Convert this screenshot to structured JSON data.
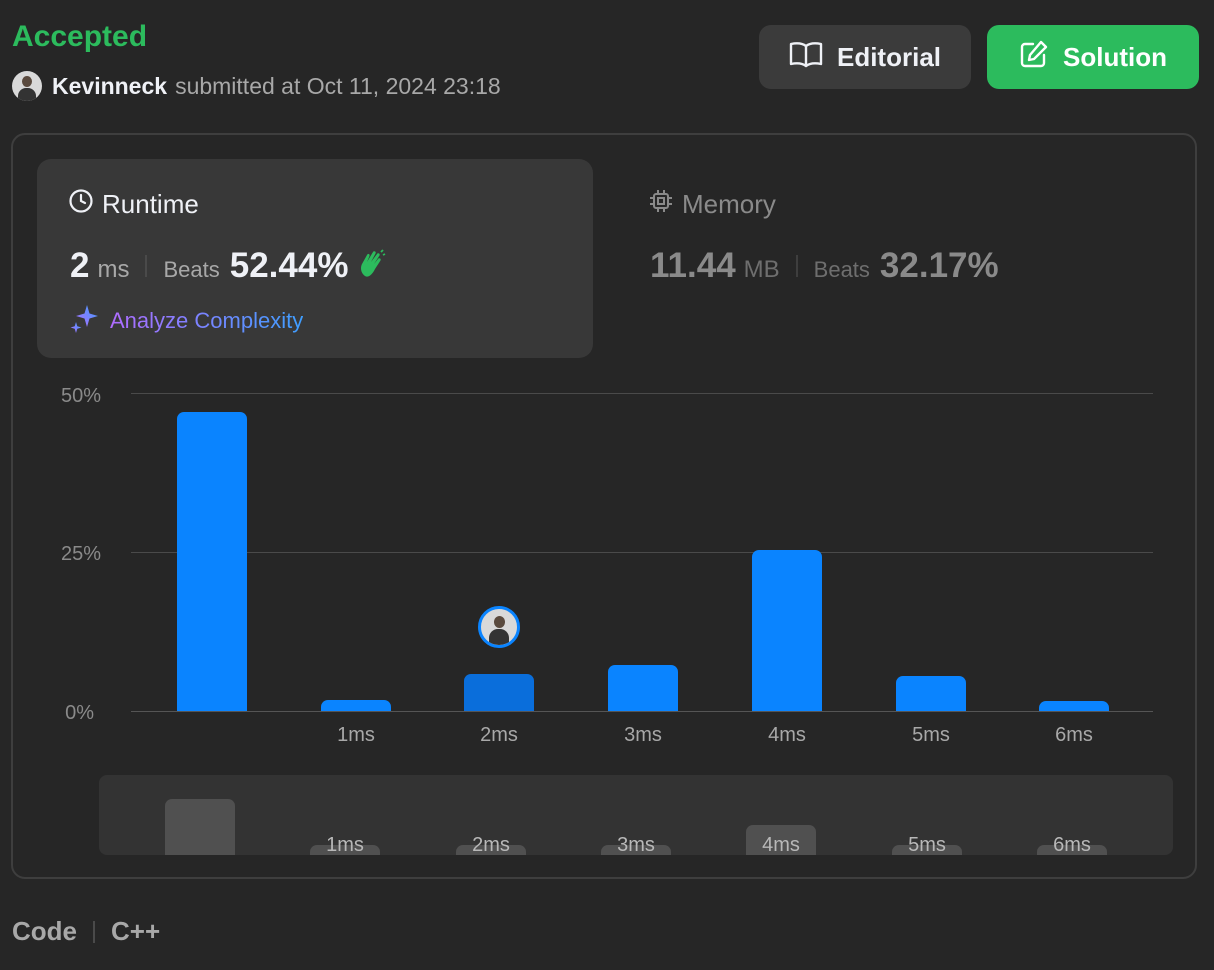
{
  "header": {
    "status": "Accepted",
    "username": "Kevinneck",
    "submitted_text": "submitted at Oct 11, 2024 23:18"
  },
  "buttons": {
    "editorial": "Editorial",
    "solution": "Solution"
  },
  "runtime": {
    "title": "Runtime",
    "value": "2",
    "unit": "ms",
    "beats_label": "Beats",
    "beats_value": "52.44%",
    "analyze_label": "Analyze Complexity"
  },
  "memory": {
    "title": "Memory",
    "value": "11.44",
    "unit": "MB",
    "beats_label": "Beats",
    "beats_value": "32.17%"
  },
  "chart_data": {
    "type": "bar",
    "categories": [
      "",
      "1ms",
      "2ms",
      "3ms",
      "4ms",
      "5ms",
      "6ms"
    ],
    "values": [
      47,
      1.7,
      5.8,
      7.3,
      25.3,
      5.5,
      1.6
    ],
    "yticks": [
      "50%",
      "25%",
      "0%"
    ],
    "ylim": [
      0,
      50
    ],
    "highlight_index": 2
  },
  "mini_chart": {
    "labels": [
      "",
      "1ms",
      "2ms",
      "3ms",
      "4ms",
      "5ms",
      "6ms"
    ]
  },
  "footer": {
    "code_label": "Code",
    "language": "C++"
  },
  "colors": {
    "accent_green": "#2cbb5d",
    "bar_blue": "#0a84ff"
  }
}
